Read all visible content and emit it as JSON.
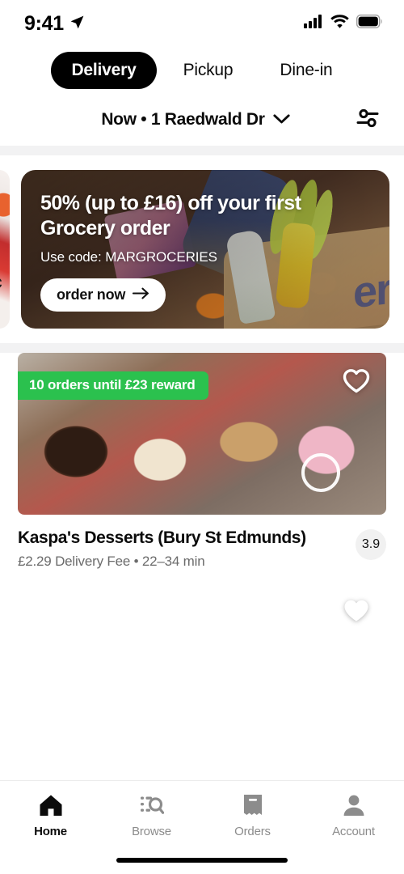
{
  "statusbar": {
    "time": "9:41",
    "location_icon": "location-arrow-icon",
    "signal_icon": "cellular-signal-icon",
    "wifi_icon": "wifi-icon",
    "battery_icon": "battery-full-icon"
  },
  "header": {
    "tabs": [
      {
        "label": "Delivery",
        "active": true
      },
      {
        "label": "Pickup",
        "active": false
      },
      {
        "label": "Dine-in",
        "active": false
      }
    ],
    "address": "Now • 1 Raedwald Dr",
    "address_chevron_icon": "chevron-down-icon",
    "filter_icon": "filter-sliders-icon"
  },
  "promo": {
    "title": "50% (up to £16) off your first Grocery order",
    "subtitle": "Use code: MARGROCERIES",
    "cta_label": "order now",
    "cta_arrow": "arrow-right-icon"
  },
  "stores": [
    {
      "name": "Kaspa's Desserts (Bury St Edmunds)",
      "meta": "£2.29 Delivery Fee • 22–34 min",
      "rating": "3.9",
      "badge": "10 orders until £23 reward",
      "badge_color": "#2BC14E",
      "favourite_icon": "heart-outline-icon",
      "favourited": false,
      "has_video_ring": true
    },
    {
      "name": "",
      "meta": "",
      "rating": "",
      "badge": "",
      "badge_color": "#2BC14E",
      "favourite_icon": "heart-filled-icon",
      "favourited": true,
      "has_video_ring": false
    }
  ],
  "tabbar": {
    "items": [
      {
        "label": "Home",
        "icon": "home-icon",
        "active": true
      },
      {
        "label": "Browse",
        "icon": "search-list-icon",
        "active": false
      },
      {
        "label": "Orders",
        "icon": "receipt-icon",
        "active": false
      },
      {
        "label": "Account",
        "icon": "person-icon",
        "active": false
      }
    ]
  },
  "colors": {
    "accent_black": "#000000",
    "reward_green": "#2BC14E",
    "muted_text": "#6B6B6B"
  }
}
